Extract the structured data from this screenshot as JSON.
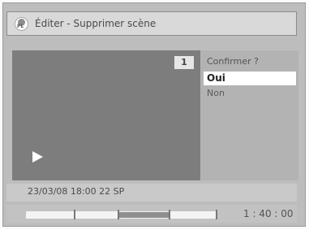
{
  "title": {
    "icon": "playlist-disc-icon",
    "icon_label": "PL",
    "text": "Éditer - Supprimer scène"
  },
  "preview": {
    "scene_number": "1",
    "status_icon": "play-icon"
  },
  "confirm": {
    "prompt": "Confirmer ?",
    "options": [
      "Oui",
      "Non"
    ],
    "selected": "Oui"
  },
  "info": {
    "recording": "23/03/08  18:00  22  SP"
  },
  "timeline": {
    "time": "1 : 40 : 00"
  }
}
